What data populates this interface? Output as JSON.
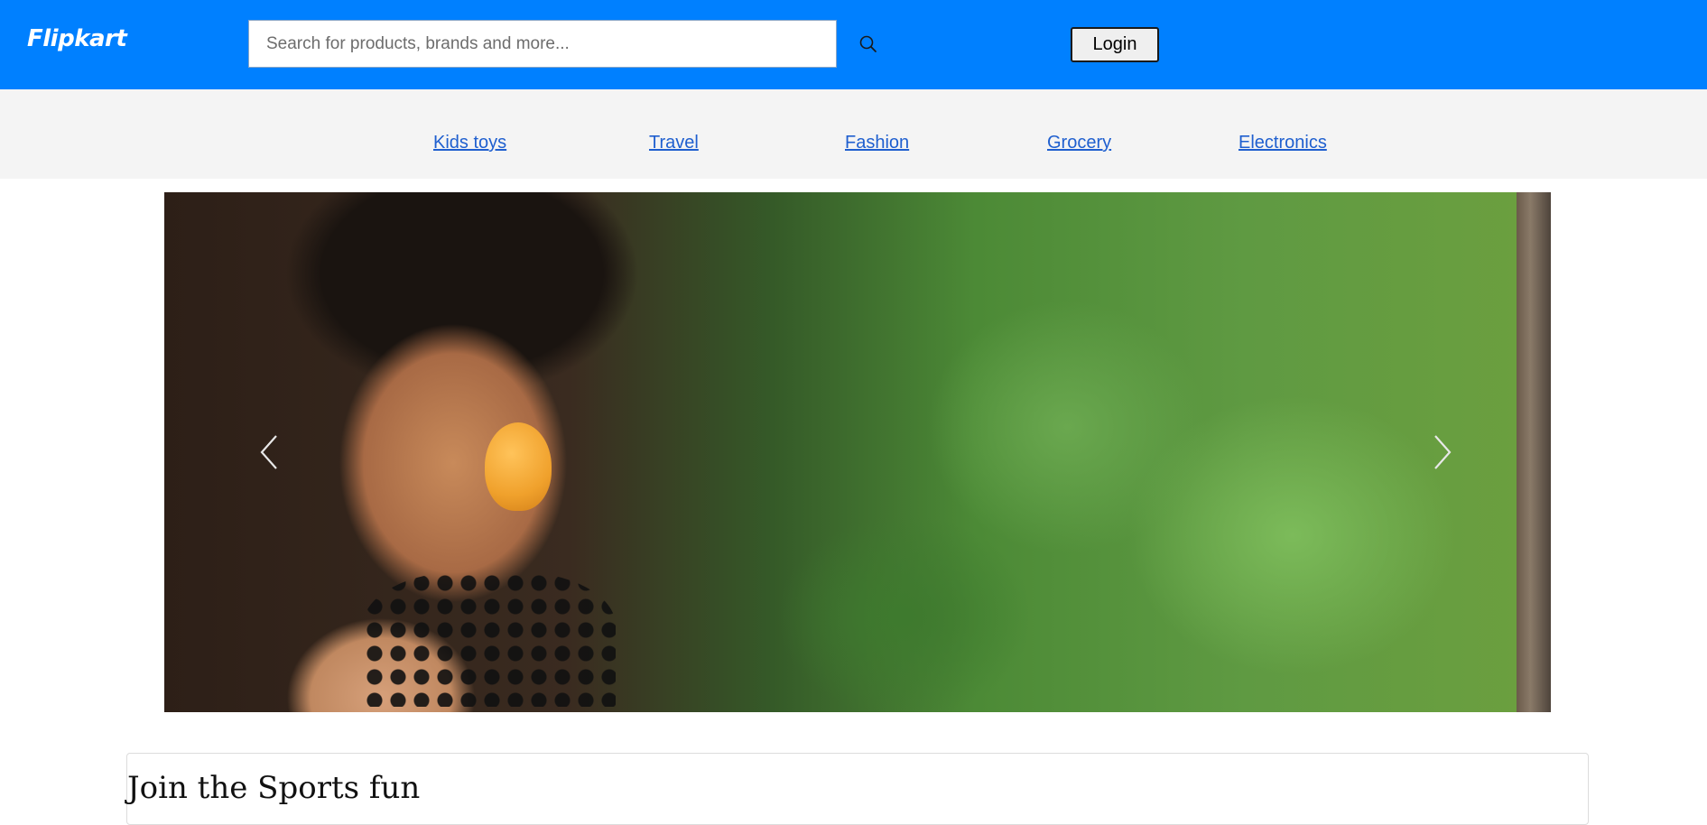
{
  "header": {
    "brand": "Flipkart",
    "search_placeholder": "Search for products, brands and more...",
    "search_icon": "search-icon",
    "login_label": "Login",
    "bg_color": "#0080ff"
  },
  "categories": [
    {
      "label": "Kids toys"
    },
    {
      "label": "Travel"
    },
    {
      "label": "Fashion"
    },
    {
      "label": "Grocery"
    },
    {
      "label": "Electronics"
    }
  ],
  "carousel": {
    "prev_icon": "chevron-left-icon",
    "next_icon": "chevron-right-icon"
  },
  "section": {
    "title": "Join the Sports fun"
  }
}
